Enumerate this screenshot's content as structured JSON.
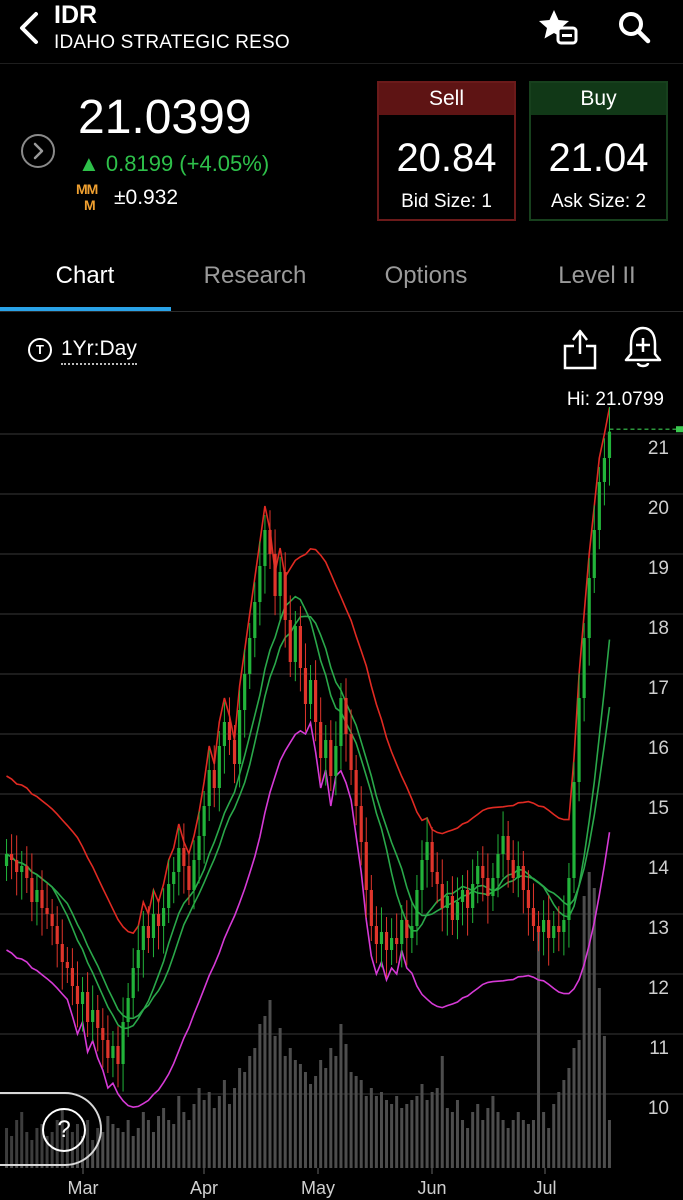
{
  "header": {
    "ticker": "IDR",
    "company": "IDAHO STRATEGIC RESO",
    "icons": {
      "back": "chevron-left-icon",
      "watchlist": "star-add-icon",
      "search": "search-icon"
    }
  },
  "quote": {
    "last": "21.0399",
    "change": "▲ 0.8199 (+4.05%)",
    "mm_label_1": "MM",
    "mm_label_2": "M",
    "expected_move": "±0.932",
    "change_color": "#2ec04a"
  },
  "sell": {
    "label": "Sell",
    "price": "20.84",
    "size": "Bid Size: 1"
  },
  "buy": {
    "label": "Buy",
    "price": "21.04",
    "size": "Ask Size: 2"
  },
  "tabs": [
    {
      "label": "Chart",
      "active": true
    },
    {
      "label": "Research",
      "active": false
    },
    {
      "label": "Options",
      "active": false
    },
    {
      "label": "Level II",
      "active": false
    }
  ],
  "chart_controls": {
    "timeframe_icon": "T",
    "timeframe": "1Yr:Day",
    "hi": "Hi: 21.0799"
  },
  "help": {
    "label": "?"
  },
  "chart_data": {
    "type": "candlestick",
    "y_ticks": [
      21,
      20,
      19,
      18,
      17,
      16,
      15,
      14,
      13,
      12,
      11,
      10
    ],
    "ylim": [
      9.2,
      21.3
    ],
    "x_ticks": [
      "Mar",
      "Apr",
      "May",
      "Jun",
      "Jul"
    ],
    "hi": 21.0799,
    "last": 21.0399,
    "grid": true,
    "colors": {
      "up": "#22b33a",
      "down": "#e0352b",
      "upper_band": "#e02a22",
      "lower_band": "#d63ad6",
      "ma": "#2aa84a",
      "volume": "#555555"
    },
    "closes": [
      14.0,
      13.9,
      13.7,
      13.8,
      13.6,
      13.2,
      13.4,
      13.1,
      13.0,
      12.8,
      12.5,
      12.2,
      12.1,
      11.8,
      11.5,
      11.7,
      11.2,
      11.4,
      11.1,
      10.9,
      10.6,
      10.8,
      10.5,
      11.2,
      11.6,
      12.1,
      12.4,
      12.8,
      12.6,
      13.0,
      12.8,
      13.1,
      13.5,
      13.7,
      14.1,
      13.8,
      13.4,
      13.9,
      14.3,
      14.8,
      15.4,
      15.1,
      15.8,
      16.2,
      15.9,
      15.5,
      16.4,
      17.0,
      17.6,
      18.2,
      18.8,
      19.4,
      19.0,
      18.3,
      18.7,
      17.9,
      17.2,
      17.8,
      17.1,
      16.5,
      16.9,
      16.2,
      15.6,
      15.9,
      15.3,
      15.8,
      16.6,
      16.0,
      15.4,
      14.8,
      14.2,
      13.4,
      12.8,
      12.5,
      12.7,
      12.4,
      12.6,
      12.5,
      12.9,
      12.6,
      12.8,
      13.4,
      13.9,
      14.2,
      13.7,
      13.5,
      13.1,
      13.3,
      12.9,
      13.2,
      13.4,
      13.1,
      13.5,
      13.8,
      13.6,
      13.3,
      13.6,
      14.0,
      14.3,
      13.9,
      13.6,
      13.8,
      13.4,
      13.1,
      12.8,
      12.7,
      12.9,
      12.6,
      12.8,
      12.7,
      12.9,
      13.6,
      15.2,
      16.6,
      17.6,
      18.6,
      19.4,
      20.2,
      20.6,
      21.04
    ],
    "volumes": [
      0.1,
      0.08,
      0.12,
      0.14,
      0.09,
      0.07,
      0.1,
      0.11,
      0.08,
      0.09,
      0.12,
      0.15,
      0.1,
      0.09,
      0.11,
      0.08,
      0.12,
      0.07,
      0.1,
      0.09,
      0.13,
      0.11,
      0.1,
      0.09,
      0.12,
      0.08,
      0.1,
      0.14,
      0.12,
      0.09,
      0.13,
      0.15,
      0.12,
      0.11,
      0.18,
      0.14,
      0.12,
      0.16,
      0.2,
      0.17,
      0.19,
      0.15,
      0.18,
      0.22,
      0.16,
      0.2,
      0.25,
      0.24,
      0.28,
      0.3,
      0.36,
      0.38,
      0.42,
      0.33,
      0.35,
      0.28,
      0.3,
      0.27,
      0.26,
      0.24,
      0.21,
      0.23,
      0.27,
      0.25,
      0.3,
      0.28,
      0.36,
      0.31,
      0.24,
      0.23,
      0.22,
      0.18,
      0.2,
      0.18,
      0.19,
      0.17,
      0.16,
      0.18,
      0.15,
      0.16,
      0.17,
      0.18,
      0.21,
      0.17,
      0.19,
      0.2,
      0.28,
      0.15,
      0.14,
      0.17,
      0.12,
      0.1,
      0.14,
      0.16,
      0.12,
      0.15,
      0.18,
      0.14,
      0.12,
      0.1,
      0.12,
      0.14,
      0.12,
      0.11,
      0.12,
      0.6,
      0.14,
      0.1,
      0.16,
      0.19,
      0.22,
      0.25,
      0.3,
      0.32,
      0.68,
      0.74,
      0.7,
      0.45,
      0.33,
      0.12
    ]
  }
}
